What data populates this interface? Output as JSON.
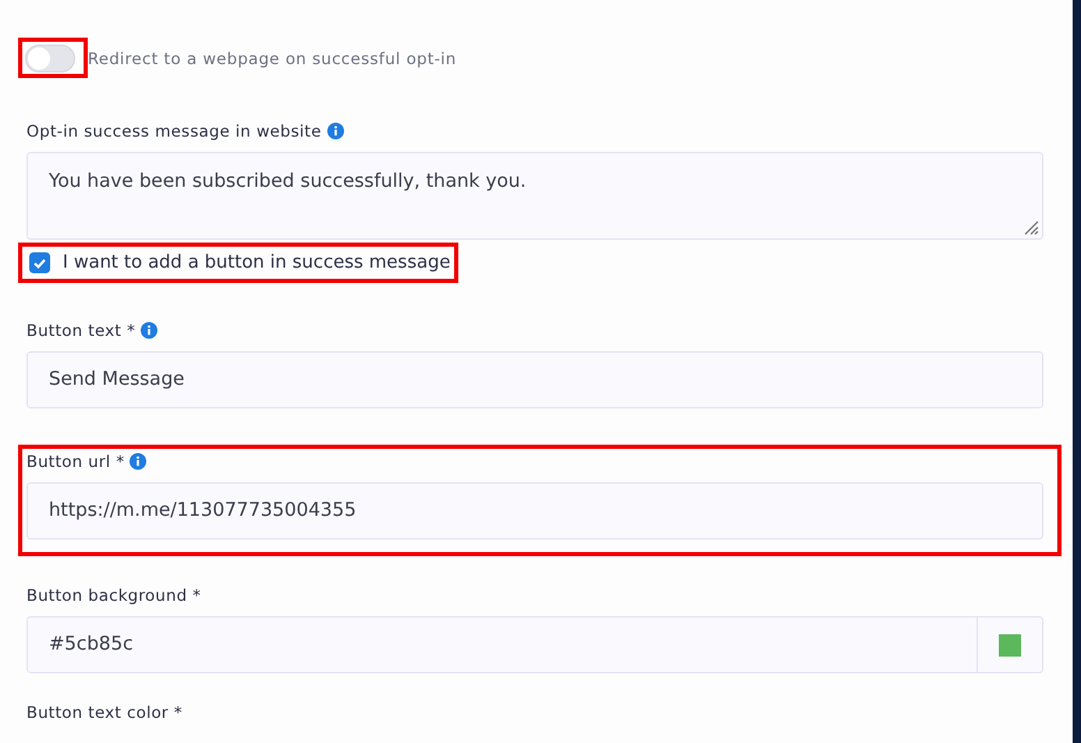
{
  "redirect": {
    "label": "Redirect to a webpage on successful opt-in",
    "on": false,
    "annotated": true
  },
  "fields": [
    {
      "kind": "textarea",
      "label": "Opt-in success message in website",
      "info": true,
      "value": "You have been subscribed successfully, thank you."
    },
    {
      "kind": "checkbox",
      "label": "I want to add a button in success message",
      "checked": true,
      "annotated": true
    },
    {
      "kind": "text",
      "label": "Button text *",
      "info": true,
      "value": "Send Message"
    },
    {
      "kind": "text",
      "label": "Button url *",
      "info": true,
      "value": "https://m.me/113077735004355",
      "annotated": true
    },
    {
      "kind": "color",
      "label": "Button background *",
      "value": "#5cb85c"
    },
    {
      "kind": "label",
      "label": "Button text color *"
    }
  ]
}
